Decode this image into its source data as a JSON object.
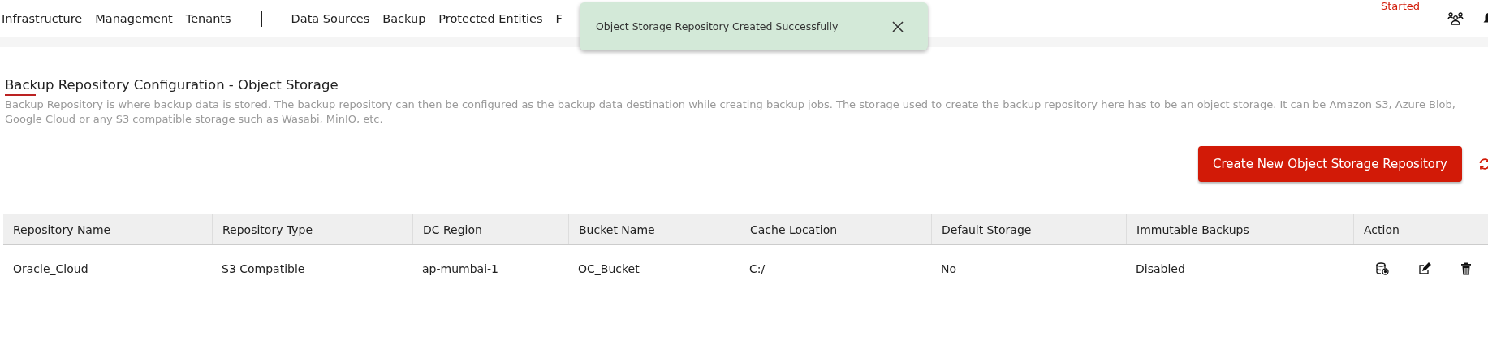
{
  "nav": {
    "left_items": [
      "Infrastructure",
      "Management",
      "Tenants"
    ],
    "right_items": [
      "Data Sources",
      "Backup",
      "Protected Entities",
      "F"
    ],
    "status": "Started"
  },
  "toast": {
    "message": "Object Storage Repository Created Successfully",
    "kind": "success"
  },
  "page": {
    "title": "Backup Repository Configuration - Object Storage",
    "description": "Backup Repository is where backup data is stored. The backup repository can then be configured as the backup data destination while creating backup jobs. The storage used to create the backup repository here has to be an object storage. It can be Amazon S3, Azure Blob, Google Cloud or any S3 compatible storage such as Wasabi, MinIO, etc.",
    "create_button": "Create New Object Storage Repository"
  },
  "table": {
    "columns": [
      "Repository Name",
      "Repository Type",
      "DC Region",
      "Bucket Name",
      "Cache Location",
      "Default Storage",
      "Immutable Backups",
      "Action"
    ],
    "rows": [
      {
        "cells": [
          "Oracle_Cloud",
          "S3 Compatible",
          "ap-mumbai-1",
          "OC_Bucket",
          "C:/",
          "No",
          "Disabled"
        ]
      }
    ]
  }
}
